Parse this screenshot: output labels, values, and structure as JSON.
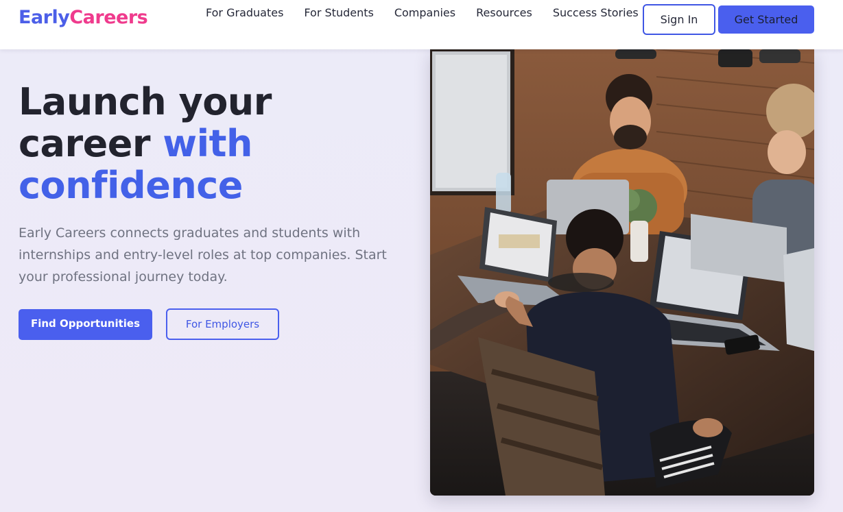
{
  "brand": {
    "part1": "Early",
    "part2": "Careers"
  },
  "nav": {
    "links": [
      "For Graduates",
      "For Students",
      "Companies",
      "Resources",
      "Success Stories"
    ],
    "sign_in": "Sign In",
    "get_started": "Get Started"
  },
  "hero": {
    "title_line1": "Launch your",
    "title_line2": "career ",
    "title_accent1": "with",
    "title_accent2": "confidence",
    "description": "Early Careers connects graduates and students with internships and entry-level roles at top companies. Start your professional journey today.",
    "primary_cta": "Find Opportunities",
    "secondary_cta": "For Employers"
  },
  "colors": {
    "accent": "#4a5fee",
    "brand_pink": "#ef3b8d",
    "heading": "#22232e",
    "body_text": "#6f7281"
  }
}
